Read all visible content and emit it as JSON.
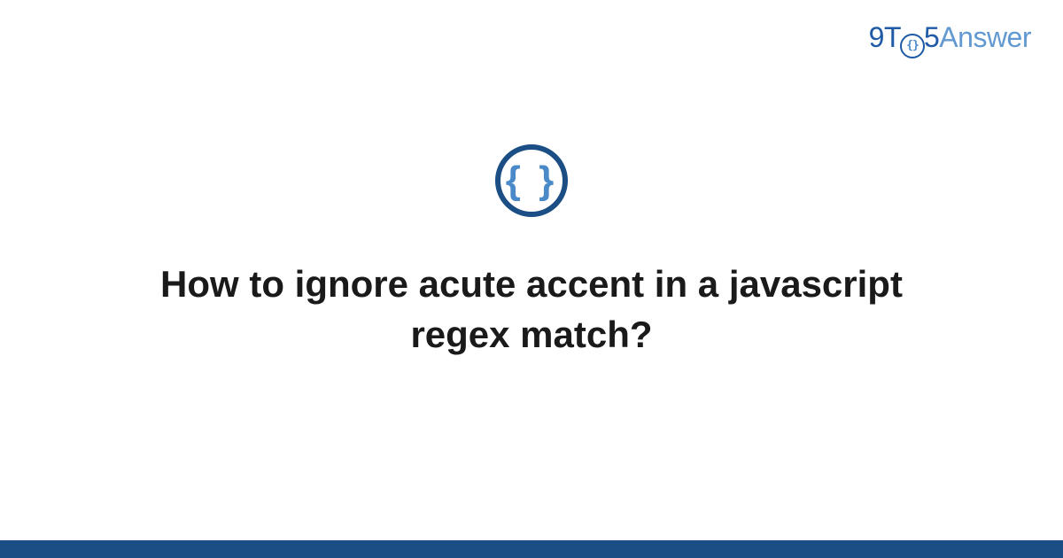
{
  "logo": {
    "part1": "9T",
    "part2_inner": "{}",
    "part3": "5",
    "part4": "Answer"
  },
  "icon": {
    "braces": "{ }"
  },
  "question": {
    "title": "How to ignore acute accent in a javascript regex match?"
  },
  "colors": {
    "primary_dark": "#1a4e84",
    "primary_light": "#4a8ac9",
    "logo_blue": "#1f5aa7",
    "logo_light": "#6299d1"
  }
}
